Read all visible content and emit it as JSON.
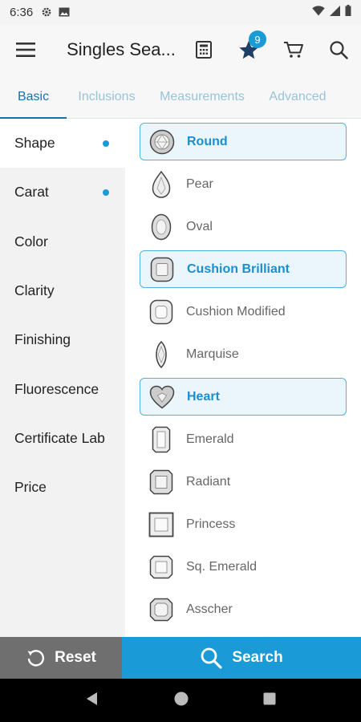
{
  "status_bar": {
    "time": "6:36"
  },
  "app_bar": {
    "title": "Singles Sea...",
    "watchlist_count": "9"
  },
  "tabs": [
    {
      "label": "Basic",
      "active": true
    },
    {
      "label": "Inclusions",
      "active": false
    },
    {
      "label": "Measurements",
      "active": false
    },
    {
      "label": "Advanced",
      "active": false
    }
  ],
  "sidebar": {
    "items": [
      {
        "label": "Shape",
        "active": true,
        "has_selection": true
      },
      {
        "label": "Carat",
        "active": false,
        "has_selection": true
      },
      {
        "label": "Color",
        "active": false,
        "has_selection": false
      },
      {
        "label": "Clarity",
        "active": false,
        "has_selection": false
      },
      {
        "label": "Finishing",
        "active": false,
        "has_selection": false
      },
      {
        "label": "Fluorescence",
        "active": false,
        "has_selection": false
      },
      {
        "label": "Certificate Lab",
        "active": false,
        "has_selection": false
      },
      {
        "label": "Price",
        "active": false,
        "has_selection": false
      }
    ]
  },
  "shapes": [
    {
      "label": "Round",
      "icon": "round-diamond-icon",
      "selected": true
    },
    {
      "label": "Pear",
      "icon": "pear-diamond-icon",
      "selected": false
    },
    {
      "label": "Oval",
      "icon": "oval-diamond-icon",
      "selected": false
    },
    {
      "label": "Cushion Brilliant",
      "icon": "cushion-brilliant-icon",
      "selected": true
    },
    {
      "label": "Cushion Modified",
      "icon": "cushion-modified-icon",
      "selected": false
    },
    {
      "label": "Marquise",
      "icon": "marquise-diamond-icon",
      "selected": false
    },
    {
      "label": "Heart",
      "icon": "heart-diamond-icon",
      "selected": true
    },
    {
      "label": "Emerald",
      "icon": "emerald-diamond-icon",
      "selected": false
    },
    {
      "label": "Radiant",
      "icon": "radiant-diamond-icon",
      "selected": false
    },
    {
      "label": "Princess",
      "icon": "princess-diamond-icon",
      "selected": false
    },
    {
      "label": "Sq. Emerald",
      "icon": "square-emerald-icon",
      "selected": false
    },
    {
      "label": "Asscher",
      "icon": "asscher-diamond-icon",
      "selected": false
    }
  ],
  "bottom_bar": {
    "reset_label": "Reset",
    "search_label": "Search"
  },
  "colors": {
    "accent": "#1a9ad6",
    "tab_active": "#1b6fa6",
    "reset_bg": "#6f6f6f"
  }
}
